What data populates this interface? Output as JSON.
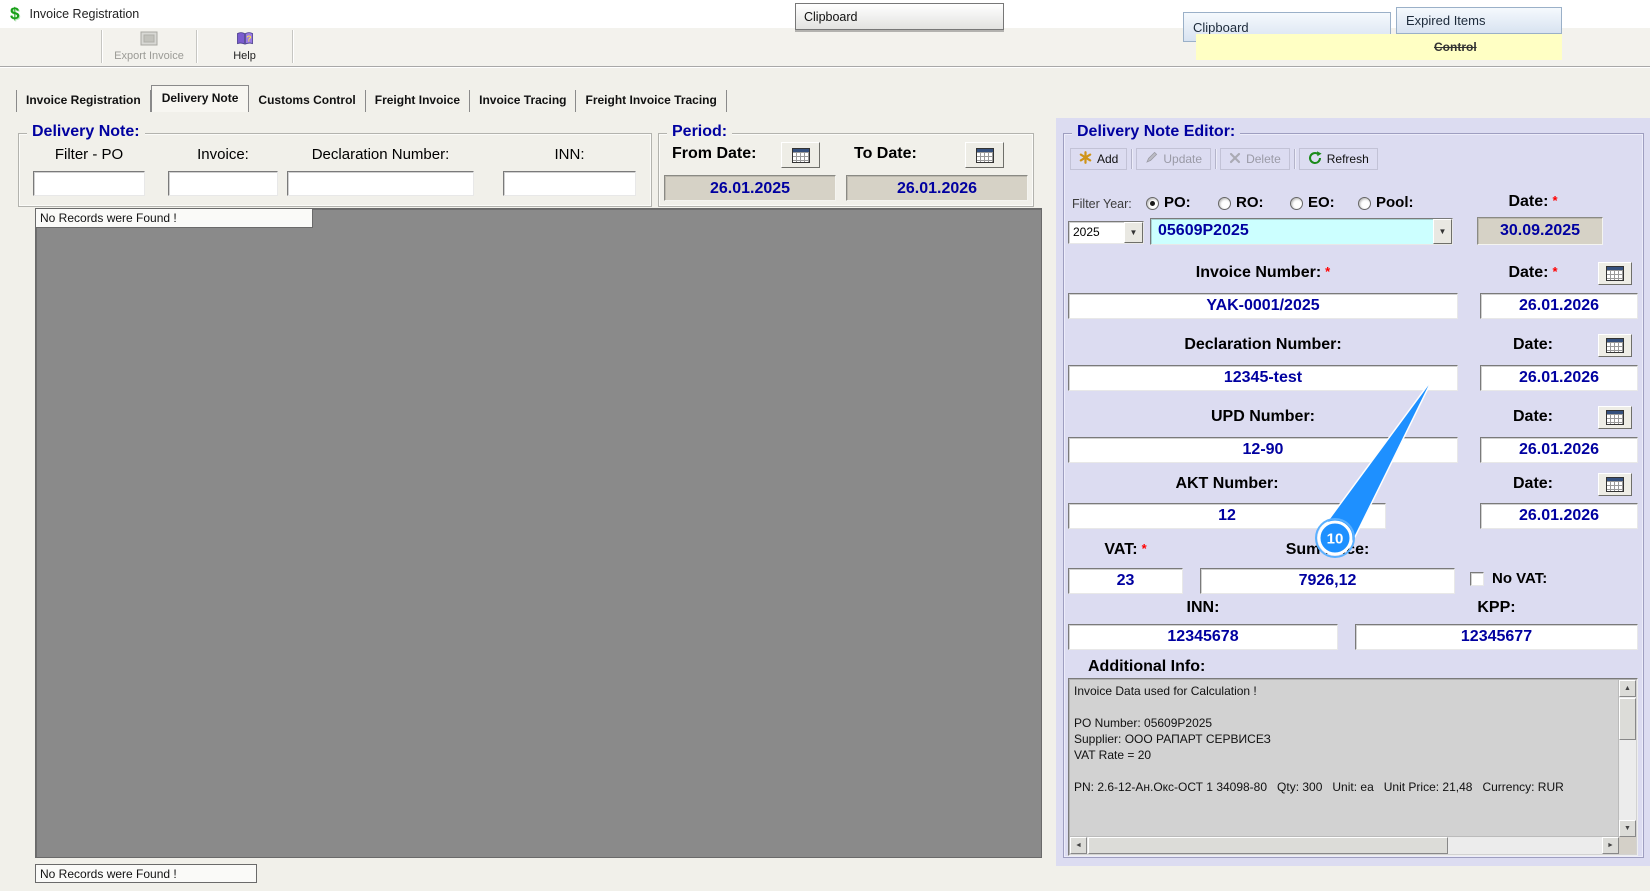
{
  "window": {
    "title": "Invoice Registration"
  },
  "floating": {
    "clipboard_top": "Clipboard",
    "clipboard_right": "Clipboard",
    "expired_items": "Expired Items",
    "partial_text": "Control"
  },
  "toolbar": {
    "export_invoice": "Export Invoice",
    "help": "Help"
  },
  "tabs": [
    {
      "label": "Invoice Registration"
    },
    {
      "label": "Delivery Note"
    },
    {
      "label": "Customs Control"
    },
    {
      "label": "Freight Invoice"
    },
    {
      "label": "Invoice Tracing"
    },
    {
      "label": "Freight Invoice Tracing"
    }
  ],
  "delivery_note": {
    "title": "Delivery Note:",
    "filter_po_label": "Filter - PO",
    "invoice_label": "Invoice:",
    "declaration_label": "Declaration Number:",
    "inn_label": "INN:",
    "filter_po_value": "",
    "invoice_value": "",
    "declaration_value": "",
    "inn_value": "",
    "no_records_top": "No Records were Found !",
    "no_records_bottom": "No Records were Found !"
  },
  "period": {
    "title": "Period:",
    "from_label": "From Date:",
    "from_value": "26.01.2025",
    "to_label": "To Date:",
    "to_value": "26.01.2026"
  },
  "editor": {
    "title": "Delivery Note Editor:",
    "required_marker": "*",
    "toolbar": {
      "add": "Add",
      "update": "Update",
      "delete": "Delete",
      "refresh": "Refresh"
    },
    "filter_year_label": "Filter Year:",
    "radios": [
      {
        "label": "PO:",
        "checked": true
      },
      {
        "label": "RO:",
        "checked": false
      },
      {
        "label": "EO:",
        "checked": false
      },
      {
        "label": "Pool:",
        "checked": false
      }
    ],
    "year_value": "2025",
    "po_value": "05609P2025",
    "po_date_label": "Date:",
    "po_date_value": "30.09.2025",
    "fields": [
      {
        "label": "Invoice Number:",
        "value": "YAK-0001/2025",
        "date_label": "Date:",
        "date_value": "26.01.2026"
      },
      {
        "label": "Declaration Number:",
        "value": "12345-test",
        "date_label": "Date:",
        "date_value": "26.01.2026"
      },
      {
        "label": "UPD Number:",
        "value": "12-90",
        "date_label": "Date:",
        "date_value": "26.01.2026"
      },
      {
        "label": "AKT Number:",
        "value": "12",
        "date_label": "Date:",
        "date_value": "26.01.2026"
      }
    ],
    "vat_label": "VAT:",
    "vat_value": "23",
    "sum_price_label": "Sum Price:",
    "sum_price_value": "7926,12",
    "no_vat_label": "No VAT:",
    "inn_label": "INN:",
    "inn_value": "12345678",
    "kpp_label": "KPP:",
    "kpp_value": "12345677",
    "additional_info_label": "Additional Info:",
    "additional_info_lines": [
      "Invoice Data used for Calculation !",
      "",
      "PO Number: 05609P2025",
      "Supplier: ООО РАПАРТ СЕРВИСЕЗ",
      "VAT Rate = 20",
      "",
      "PN: 2.6-12-Ан.Окс-ОСТ 1 34098-80   Qty: 300   Unit: ea   Unit Price: 21,48   Currency: RUR"
    ]
  },
  "callout": {
    "number": "10"
  },
  "colors": {
    "accent_navy": "#0000a0",
    "required_red": "#ff0000",
    "po_combo_bg": "#ccffff",
    "editor_bg": "#dcdcf1",
    "callout_blue": "#1e90ff"
  }
}
